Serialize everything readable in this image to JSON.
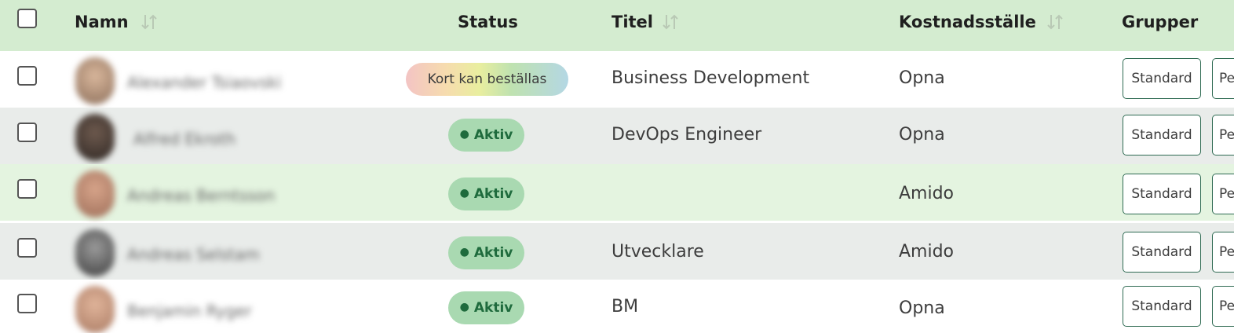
{
  "header": {
    "columns": {
      "name": "Namn",
      "status": "Status",
      "title": "Titel",
      "cost_center": "Kostnadsställe",
      "groups": "Grupper"
    }
  },
  "rows": [
    {
      "name": "Alexander Tsiaovski",
      "status": "Kort kan beställas",
      "title": "Business Development",
      "cost_center": "Opna",
      "group1": "Standard",
      "group2": "Pe"
    },
    {
      "name": "Alfred Ekroth",
      "status": "Aktiv",
      "title": "DevOps Engineer",
      "cost_center": "Opna",
      "group1": "Standard",
      "group2": "Pe"
    },
    {
      "name": "Andreas Berntsson",
      "status": "Aktiv",
      "title": "",
      "cost_center": "Amido",
      "group1": "Standard",
      "group2": "Pe"
    },
    {
      "name": "Andreas Selstam",
      "status": "Aktiv",
      "title": "Utvecklare",
      "cost_center": "Amido",
      "group1": "Standard",
      "group2": "Pe"
    },
    {
      "name": "Benjamin Ryger",
      "status": "Aktiv",
      "title": "BM",
      "cost_center": "Opna",
      "group1": "Standard",
      "group2": "Pe"
    }
  ],
  "colors": {
    "header_bg": "#d4ecd0",
    "row_alt_bg": "#e9ecea",
    "row_highlight_bg": "#e4f4e0",
    "active_badge_bg": "#a9d9b1",
    "active_badge_text": "#1f6b3d",
    "tag_border": "#2f6b53"
  },
  "icons": {
    "sort": "sort-icon",
    "checkbox": "checkbox-icon"
  }
}
